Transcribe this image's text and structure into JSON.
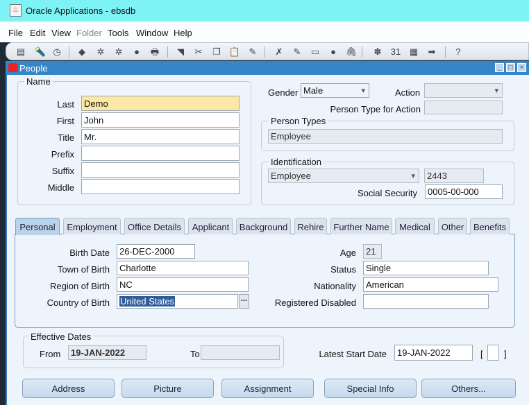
{
  "window": {
    "title": "Oracle Applications - ebsdb"
  },
  "menu": [
    "File",
    "Edit",
    "View",
    "Folder",
    "Tools",
    "Window",
    "Help"
  ],
  "toolbar_icons": [
    "new-record-icon",
    "find-icon",
    "navigator-icon",
    "save-icon",
    "next-step-icon",
    "switch-responsibility-icon",
    "print-icon",
    "close-form-icon",
    "cut-icon",
    "copy-icon",
    "paste-icon",
    "clear-record-icon",
    "delete-record-icon",
    "edit-field-icon",
    "zoom-icon",
    "translations-icon",
    "attachments-icon",
    "folder-tools-icon",
    "calendar-icon",
    "work-date-icon",
    "export-icon",
    "summary-icon",
    "help-icon"
  ],
  "form": {
    "title": "People"
  },
  "name_group": {
    "label": "Name",
    "fields": [
      {
        "label": "Last",
        "value": "Demo"
      },
      {
        "label": "First",
        "value": "John"
      },
      {
        "label": "Title",
        "value": "Mr."
      },
      {
        "label": "Prefix",
        "value": ""
      },
      {
        "label": "Suffix",
        "value": ""
      },
      {
        "label": "Middle",
        "value": ""
      }
    ]
  },
  "gender": {
    "label": "Gender",
    "value": "Male"
  },
  "action": {
    "label": "Action",
    "value": ""
  },
  "person_type_for_action": {
    "label": "Person Type for Action",
    "value": ""
  },
  "person_types": {
    "label": "Person Types",
    "value": "Employee"
  },
  "identification": {
    "label": "Identification",
    "type": "Employee",
    "number": "2443",
    "ssn_label": "Social Security",
    "ssn": "0005-00-000"
  },
  "tabs": [
    "Personal",
    "Employment",
    "Office Details",
    "Applicant",
    "Background",
    "Rehire",
    "Further Name",
    "Medical",
    "Other",
    "Benefits"
  ],
  "active_tab": "Personal",
  "personal": {
    "birth_date": {
      "label": "Birth Date",
      "value": "26-DEC-2000"
    },
    "town_of_birth": {
      "label": "Town of Birth",
      "value": "Charlotte"
    },
    "region_of_birth": {
      "label": "Region of Birth",
      "value": "NC"
    },
    "country_of_birth": {
      "label": "Country of Birth",
      "value": "United States"
    },
    "age": {
      "label": "Age",
      "value": "21"
    },
    "status": {
      "label": "Status",
      "value": "Single"
    },
    "nationality": {
      "label": "Nationality",
      "value": "American"
    },
    "registered_disabled": {
      "label": "Registered Disabled",
      "value": ""
    },
    "lov_label": "..."
  },
  "effective_dates": {
    "label": "Effective Dates",
    "from_label": "From",
    "from": "19-JAN-2022",
    "to_label": "To",
    "to": ""
  },
  "latest_start_date": {
    "label": "Latest Start Date",
    "value": "19-JAN-2022",
    "bracket_open": "[",
    "bracket_close": "]"
  },
  "buttons": [
    "Address",
    "Picture",
    "Assignment",
    "Special Info",
    "Others..."
  ]
}
